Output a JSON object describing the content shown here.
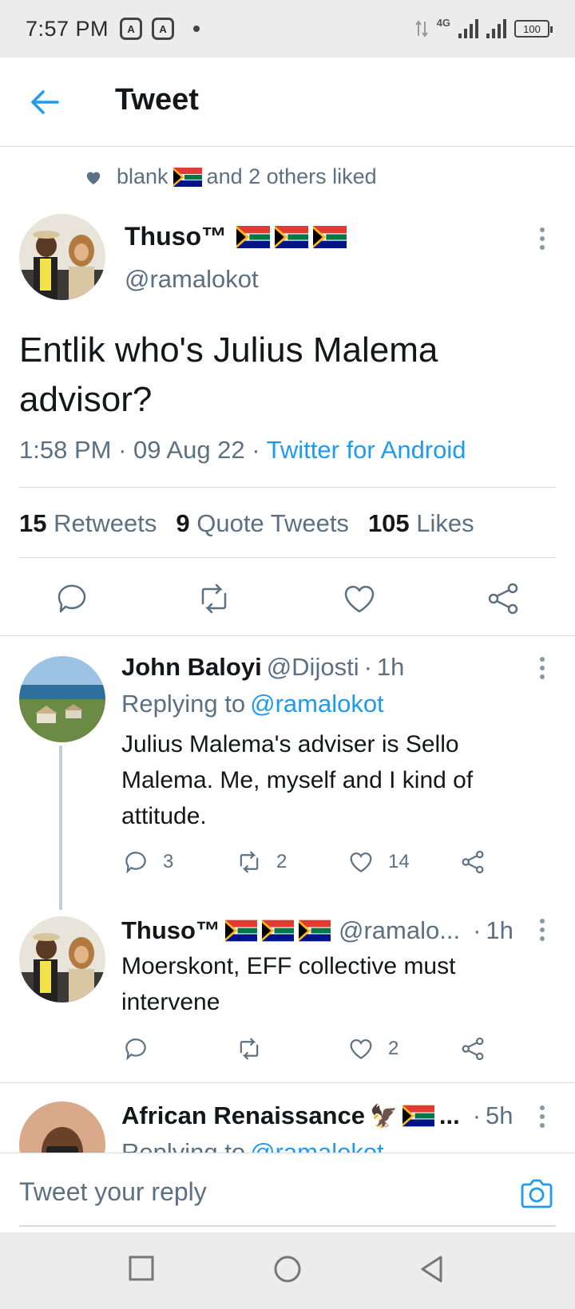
{
  "status_bar": {
    "time": "7:57 PM",
    "network": "4G",
    "battery": "100"
  },
  "header": {
    "title": "Tweet"
  },
  "social_context": {
    "text_before": "blank",
    "text_after": "and 2 others liked"
  },
  "main_tweet": {
    "author_name": "Thuso™",
    "handle": "@ramalokot",
    "text": "Entlik who's Julius Malema advisor?",
    "time": "1:58 PM",
    "date": "09 Aug 22",
    "source": "Twitter for Android",
    "retweets_count": "15",
    "retweets_label": "Retweets",
    "quotes_count": "9",
    "quotes_label": "Quote Tweets",
    "likes_count": "105",
    "likes_label": "Likes"
  },
  "replies": [
    {
      "author_name": "John Baloyi",
      "handle": "@Dijosti",
      "time": "1h",
      "replying_label": "Replying to",
      "replying_to": "@ramalokot",
      "text": "Julius Malema's adviser is Sello Malema. Me, myself and I kind of attitude.",
      "replies_count": "3",
      "retweets_count": "2",
      "likes_count": "14"
    },
    {
      "author_name": "Thuso™",
      "handle": "@ramalo...",
      "time": "1h",
      "text": "Moerskont, EFF collective must intervene",
      "likes_count": "2"
    },
    {
      "author_name": "African Renaissance",
      "ellipsis": "...",
      "time": "5h",
      "replying_label": "Replying to",
      "replying_to": "@ramalokot"
    }
  ],
  "reply_bar": {
    "placeholder": "Tweet your reply"
  },
  "colors": {
    "accent": "#1d9bf0",
    "secondary_text": "#5b7083",
    "divider": "#d9dde1"
  }
}
